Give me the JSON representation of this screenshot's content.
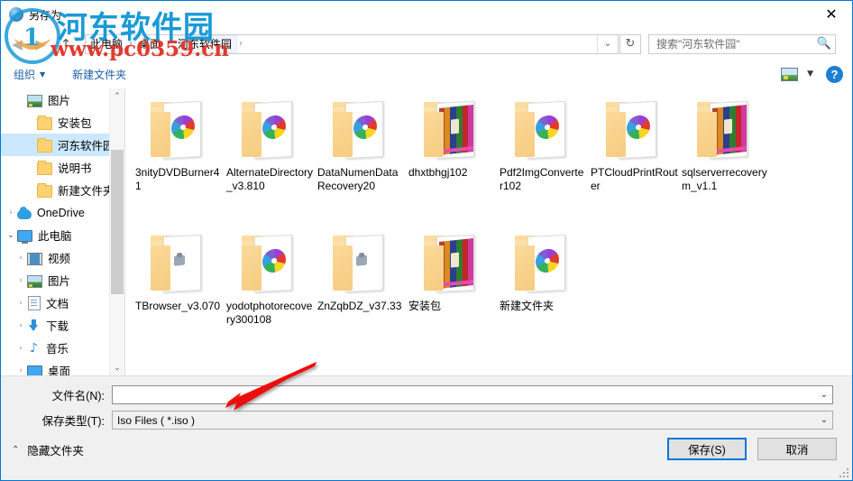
{
  "window": {
    "title": "另存为",
    "icon": "disc-icon",
    "close_label": "✕"
  },
  "nav": {
    "back_icon": "◀",
    "forward_icon": "▶",
    "up_icon": "↑",
    "refresh_icon": "↻",
    "address_dropdown_icon": "⌄",
    "breadcrumbs": [
      "此电脑",
      "桌面",
      "河东软件园"
    ],
    "separator": "›"
  },
  "search": {
    "placeholder": "搜索\"河东软件园\"",
    "icon": "search-icon"
  },
  "toolbar": {
    "organize_label": "组织",
    "organize_caret": "▼",
    "new_folder_label": "新建文件夹",
    "view_caret": "▼",
    "help_label": "?"
  },
  "sidebar": {
    "items": [
      {
        "label": "图片",
        "icon": "picture-icon",
        "indent": 1,
        "twisty": "",
        "selected": false,
        "pinned": true
      },
      {
        "label": "安装包",
        "icon": "folder-icon",
        "indent": 2,
        "twisty": "",
        "selected": false,
        "pinned": false
      },
      {
        "label": "河东软件园",
        "icon": "folder-icon",
        "indent": 2,
        "twisty": "",
        "selected": true,
        "pinned": false
      },
      {
        "label": "说明书",
        "icon": "folder-icon",
        "indent": 2,
        "twisty": "",
        "selected": false,
        "pinned": false
      },
      {
        "label": "新建文件夹",
        "icon": "folder-icon",
        "indent": 2,
        "twisty": "",
        "selected": false,
        "pinned": false
      },
      {
        "label": "OneDrive",
        "icon": "cloud-icon",
        "indent": 0,
        "twisty": "›",
        "selected": false,
        "pinned": false
      },
      {
        "label": "此电脑",
        "icon": "monitor-icon",
        "indent": 0,
        "twisty": "⌄",
        "selected": false,
        "pinned": false
      },
      {
        "label": "视频",
        "icon": "video-icon",
        "indent": 1,
        "twisty": "›",
        "selected": false,
        "pinned": false
      },
      {
        "label": "图片",
        "icon": "picture-icon",
        "indent": 1,
        "twisty": "›",
        "selected": false,
        "pinned": false
      },
      {
        "label": "文档",
        "icon": "document-icon",
        "indent": 1,
        "twisty": "›",
        "selected": false,
        "pinned": false
      },
      {
        "label": "下载",
        "icon": "download-icon",
        "indent": 1,
        "twisty": "›",
        "selected": false,
        "pinned": false
      },
      {
        "label": "音乐",
        "icon": "music-icon",
        "indent": 1,
        "twisty": "›",
        "selected": false,
        "pinned": false
      },
      {
        "label": "桌面",
        "icon": "desktop-icon",
        "indent": 1,
        "twisty": "›",
        "selected": false,
        "pinned": false
      }
    ],
    "scroll_up_icon": "⌃",
    "scroll_down_icon": "⌄"
  },
  "files": [
    {
      "name": "3nityDVDBurner41",
      "thumb": "pinwheel"
    },
    {
      "name": "AlternateDirectory_v3.810",
      "thumb": "pinwheel"
    },
    {
      "name": "DataNumenDataRecovery20",
      "thumb": "pinwheel"
    },
    {
      "name": "dhxtbhgj102",
      "thumb": "stripes"
    },
    {
      "name": "Pdf2ImgConverter102",
      "thumb": "pinwheel"
    },
    {
      "name": "PTCloudPrintRouter",
      "thumb": "pinwheel"
    },
    {
      "name": "sqlserverrecoverym_v1.1",
      "thumb": "stripes"
    },
    {
      "name": "TBrowser_v3.070",
      "thumb": "cog"
    },
    {
      "name": "yodotphotorecovery300108",
      "thumb": "pinwheel"
    },
    {
      "name": "ZnZqbDZ_v37.33",
      "thumb": "cog"
    },
    {
      "name": "安装包",
      "thumb": "stripes"
    },
    {
      "name": "新建文件夹",
      "thumb": "pinwheel"
    }
  ],
  "form": {
    "filename_label": "文件名(N):",
    "filename_value": "",
    "filetype_label": "保存类型(T):",
    "filetype_value": "Iso  Files ( *.iso )",
    "dropdown_caret": "⌄",
    "hide_folders_label": "隐藏文件夹",
    "hide_folders_caret": "⌃",
    "save_label": "保存(S)",
    "cancel_label": "取消"
  },
  "watermark": {
    "title": "河东软件园",
    "url": "www.pc0359.cn"
  },
  "colors": {
    "accent": "#0078d7",
    "selection": "#cce8ff",
    "link": "#1a5fa8",
    "annotation": "#ee1111"
  }
}
